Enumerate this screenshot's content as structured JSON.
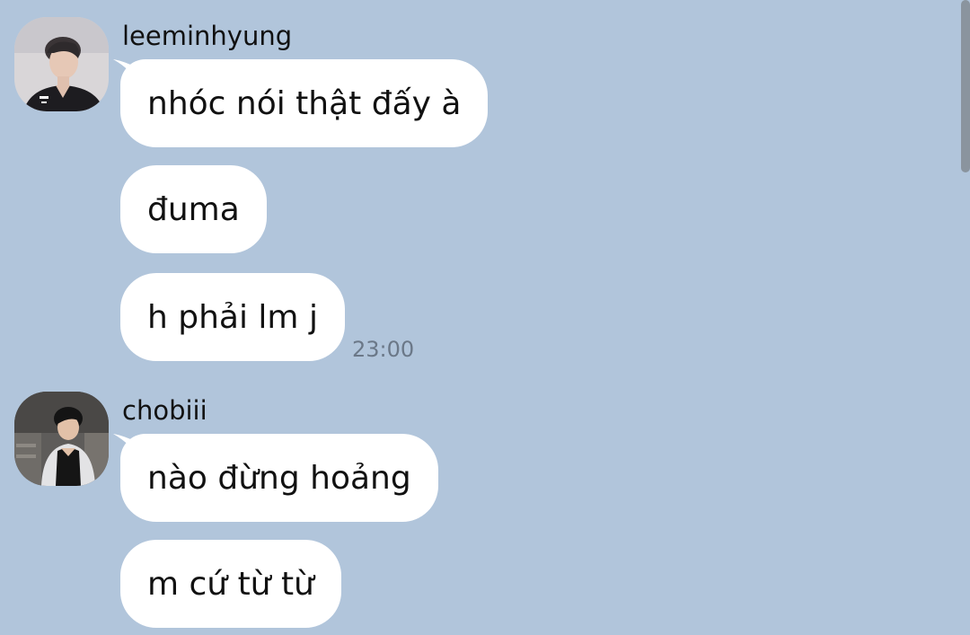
{
  "colors": {
    "background": "#b1c5db",
    "bubble": "#ffffff",
    "text": "#111111",
    "timestamp": "#6b7888",
    "scrollbar": "#8a949e"
  },
  "messages": [
    {
      "sender": "leeminhyung",
      "avatar_icon": "user-avatar-icon",
      "bubbles": [
        "nhóc nói thật đấy à",
        "đuma",
        "h phải lm j"
      ],
      "time": "23:00"
    },
    {
      "sender": "chobiii",
      "avatar_icon": "user-avatar-icon",
      "bubbles": [
        "nào đừng hoảng",
        "m cứ từ từ"
      ]
    }
  ]
}
